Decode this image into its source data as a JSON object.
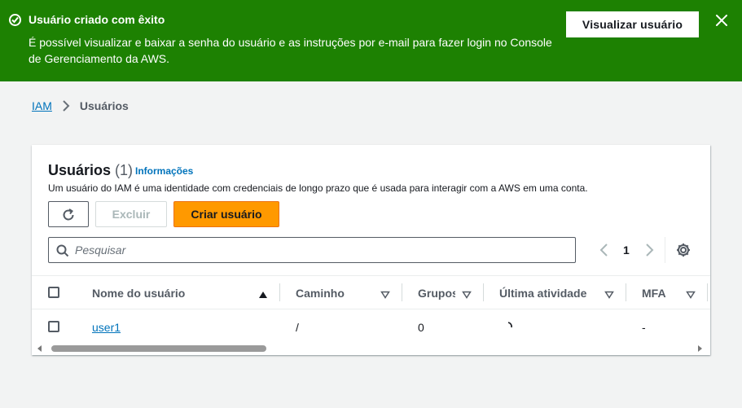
{
  "flash": {
    "title": "Usuário criado com êxito",
    "message": "É possível visualizar e baixar a senha do usuário e as instruções por e-mail para fazer login no Console de Gerenciamento da AWS.",
    "view_button": "Visualizar usuário",
    "color": "#1d8102"
  },
  "breadcrumb": {
    "root": "IAM",
    "current": "Usuários"
  },
  "users_panel": {
    "title": "Usuários",
    "count": "(1)",
    "info_link": "Informações",
    "description": "Um usuário do IAM é uma identidade com credenciais de longo prazo que é usada para interagir com a AWS em uma conta.",
    "delete_button": "Excluir",
    "create_button": "Criar usuário",
    "search_placeholder": "Pesquisar",
    "page_number": "1",
    "accent": "#ff9900",
    "link_color": "#0073bb"
  },
  "table": {
    "columns": [
      {
        "label": "Nome do usuário",
        "sort": "ascending"
      },
      {
        "label": "Caminho",
        "sort": "none"
      },
      {
        "label": "Grupos",
        "sort": "none"
      },
      {
        "label": "Última atividade",
        "sort": "none"
      },
      {
        "label": "MFA",
        "sort": "none"
      }
    ],
    "rows": [
      {
        "name": "user1",
        "path": "/",
        "groups": "0",
        "last_activity": "",
        "mfa": "-"
      }
    ]
  }
}
